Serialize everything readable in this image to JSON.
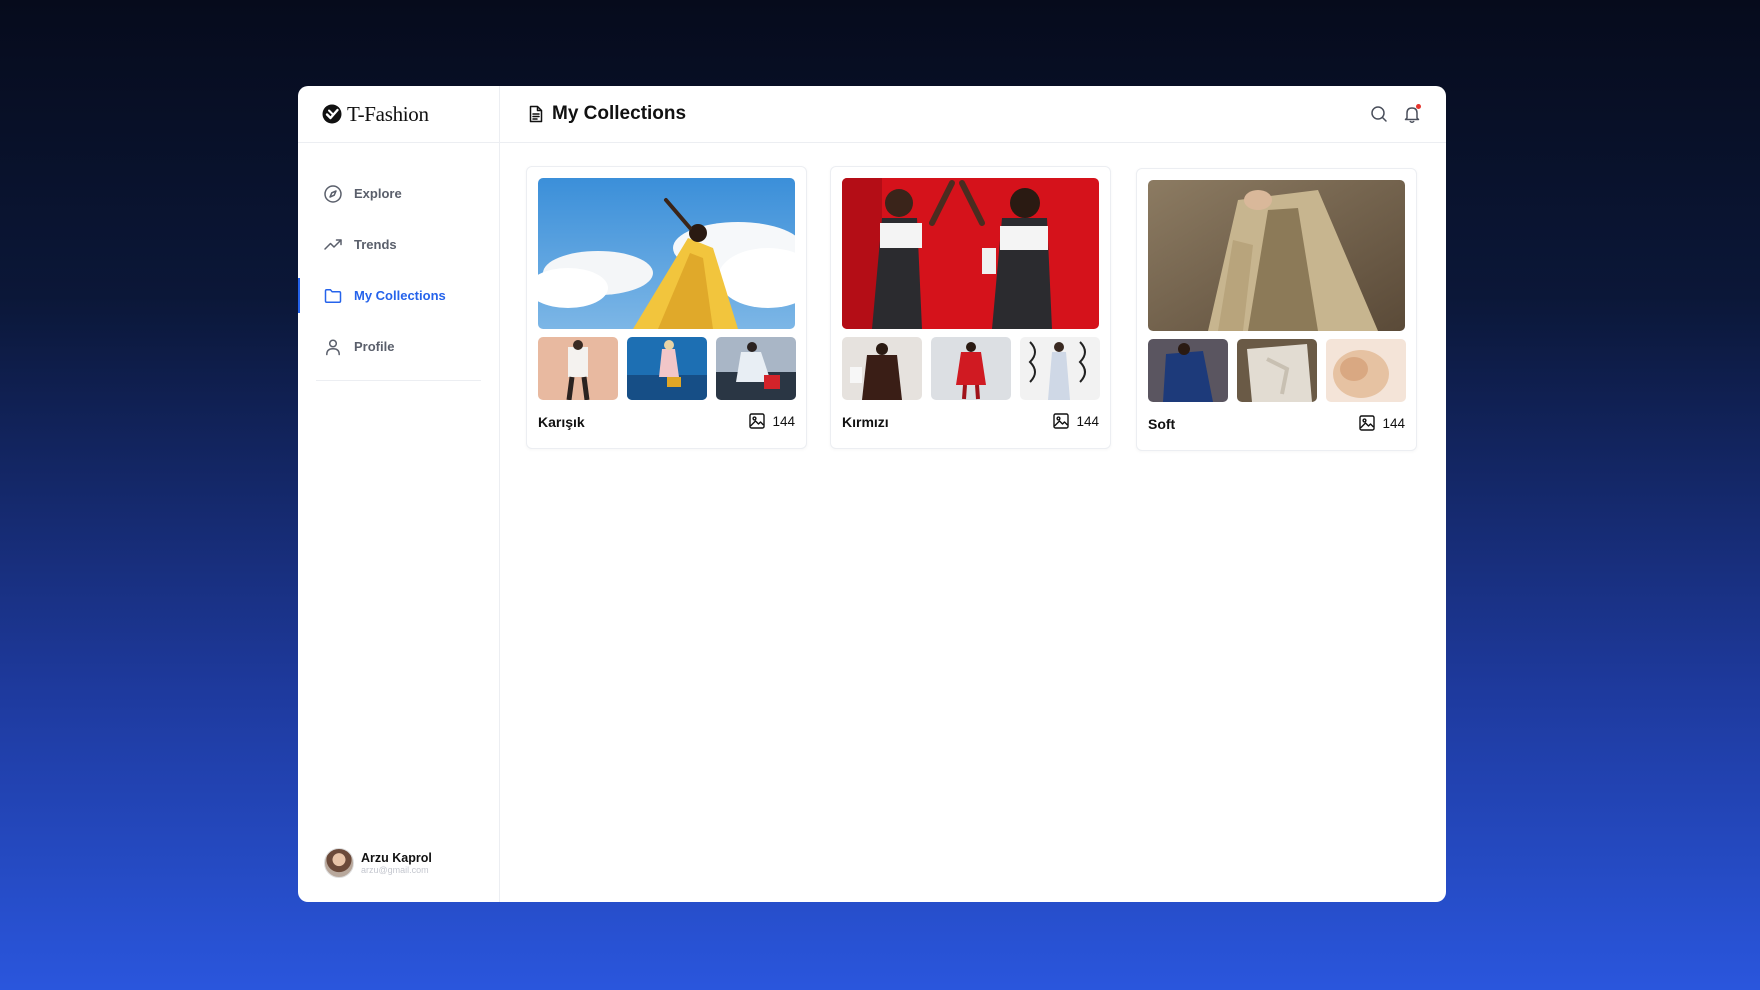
{
  "brand": {
    "name": "T-Fashion",
    "icon": "t-fashion-logo-icon"
  },
  "sidebar": {
    "items": [
      {
        "label": "Explore",
        "icon": "compass-icon",
        "active": false
      },
      {
        "label": "Trends",
        "icon": "trending-up-icon",
        "active": false
      },
      {
        "label": "My Collections",
        "icon": "folder-icon",
        "active": true
      },
      {
        "label": "Profile",
        "icon": "user-icon",
        "active": false
      }
    ],
    "user": {
      "name": "Arzu Kaprol",
      "email": "arzu@gmail.com"
    }
  },
  "header": {
    "title": "My Collections",
    "title_icon": "document-icon",
    "actions": [
      "search-icon",
      "bell-icon"
    ]
  },
  "collections": [
    {
      "name": "Karışık",
      "count": "144"
    },
    {
      "name": "Kırmızı",
      "count": "144"
    },
    {
      "name": "Soft",
      "count": "144"
    }
  ],
  "colors": {
    "accent": "#2563eb",
    "notification": "#e5342d"
  }
}
